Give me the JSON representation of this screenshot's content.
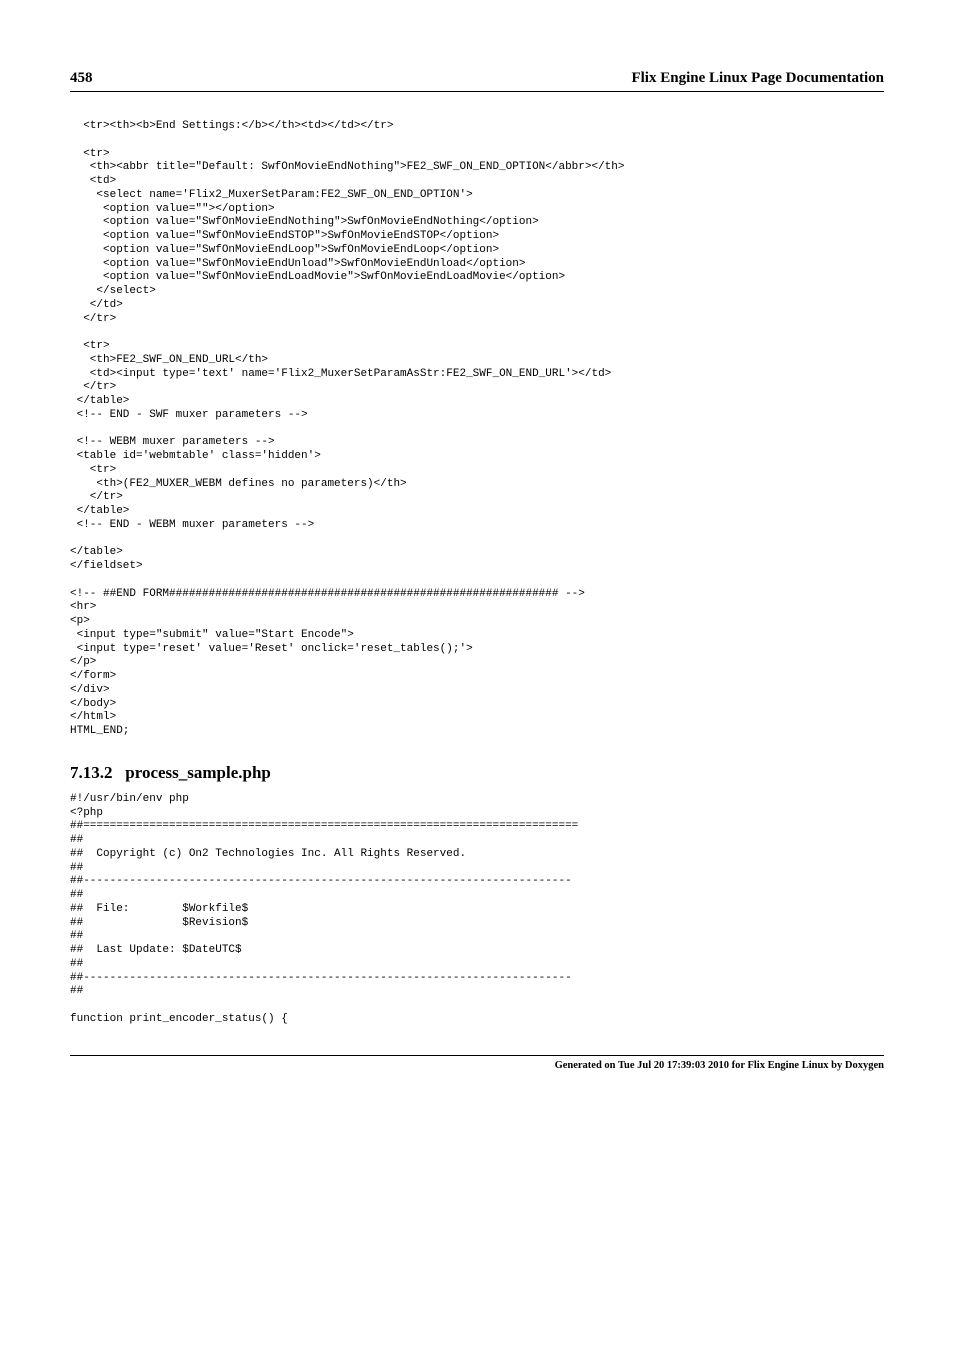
{
  "header": {
    "page_number": "458",
    "title": "Flix Engine Linux Page Documentation"
  },
  "code_block_1": "  <tr><th><b>End Settings:</b></th><td></td></tr>\n\n  <tr>\n   <th><abbr title=\"Default: SwfOnMovieEndNothing\">FE2_SWF_ON_END_OPTION</abbr></th>\n   <td>\n    <select name='Flix2_MuxerSetParam:FE2_SWF_ON_END_OPTION'>\n     <option value=\"\"></option>\n     <option value=\"SwfOnMovieEndNothing\">SwfOnMovieEndNothing</option>\n     <option value=\"SwfOnMovieEndSTOP\">SwfOnMovieEndSTOP</option>\n     <option value=\"SwfOnMovieEndLoop\">SwfOnMovieEndLoop</option>\n     <option value=\"SwfOnMovieEndUnload\">SwfOnMovieEndUnload</option>\n     <option value=\"SwfOnMovieEndLoadMovie\">SwfOnMovieEndLoadMovie</option>\n    </select>\n   </td>\n  </tr>\n\n  <tr>\n   <th>FE2_SWF_ON_END_URL</th>\n   <td><input type='text' name='Flix2_MuxerSetParamAsStr:FE2_SWF_ON_END_URL'></td>\n  </tr>\n </table>\n <!-- END - SWF muxer parameters -->\n\n <!-- WEBM muxer parameters -->\n <table id='webmtable' class='hidden'>\n   <tr>\n    <th>(FE2_MUXER_WEBM defines no parameters)</th>\n   </tr>\n </table>\n <!-- END - WEBM muxer parameters -->\n\n</table>\n</fieldset>\n\n<!-- ##END FORM########################################################### -->\n<hr>\n<p>\n <input type=\"submit\" value=\"Start Encode\">\n <input type='reset' value='Reset' onclick='reset_tables();'>\n</p>\n</form>\n</div>\n</body>\n</html>\nHTML_END;",
  "section": {
    "number": "7.13.2",
    "title": "process_sample.php"
  },
  "code_block_2": "#!/usr/bin/env php\n<?php\n##===========================================================================\n##\n##  Copyright (c) On2 Technologies Inc. All Rights Reserved.\n##\n##--------------------------------------------------------------------------\n##\n##  File:        $Workfile$\n##               $Revision$\n##\n##  Last Update: $DateUTC$\n##\n##--------------------------------------------------------------------------\n##\n\nfunction print_encoder_status() {",
  "footer": {
    "text": "Generated on Tue Jul 20 17:39:03 2010 for Flix Engine Linux by Doxygen"
  }
}
